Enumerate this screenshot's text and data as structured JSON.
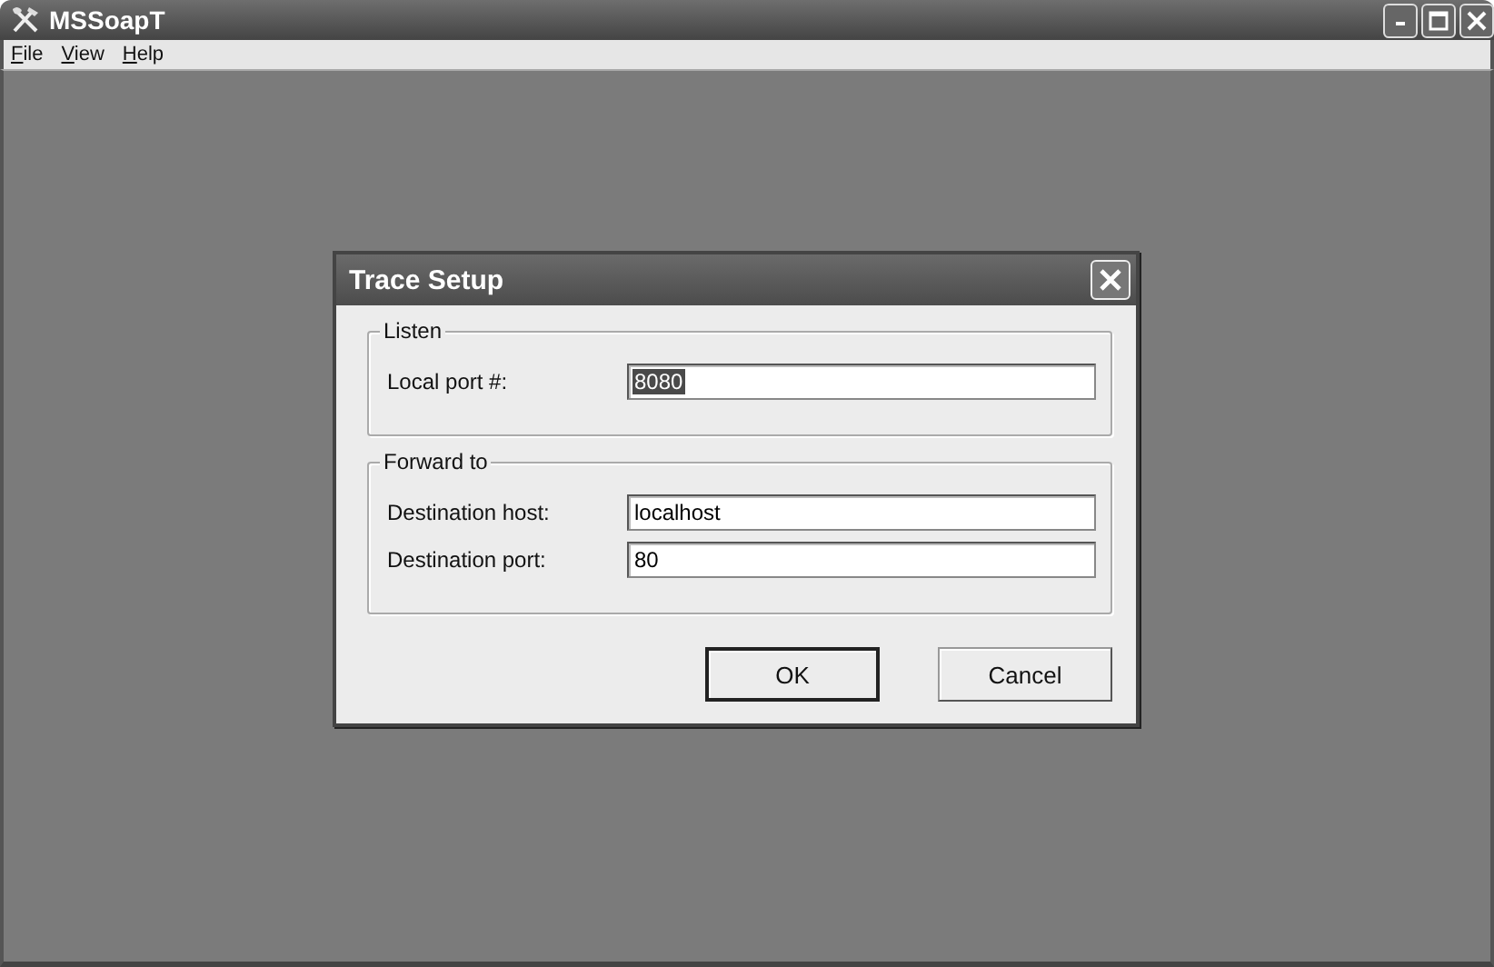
{
  "window": {
    "title": "MSSoapT"
  },
  "menu": [
    "File",
    "View",
    "Help"
  ],
  "dialog": {
    "title": "Trace Setup",
    "groups": [
      {
        "title": "Listen",
        "fields": [
          {
            "label": "Local port #:",
            "value": "8080",
            "highlighted": true
          }
        ]
      },
      {
        "title": "Forward to",
        "fields": [
          {
            "label": "Destination host:",
            "value": "localhost",
            "highlighted": false
          },
          {
            "label": "Destination port:",
            "value": "80",
            "highlighted": false
          }
        ]
      }
    ],
    "buttons": [
      {
        "label": "OK",
        "default": true
      },
      {
        "label": "Cancel",
        "default": false
      }
    ]
  }
}
